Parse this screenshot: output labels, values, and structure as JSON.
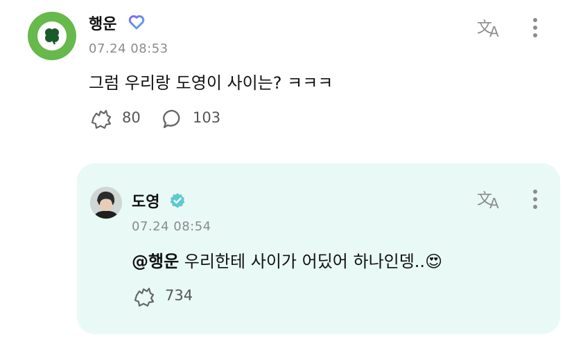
{
  "post": {
    "author": "행운",
    "badge_icon": "heart-outline-badge-icon",
    "timestamp": "07.24 08:53",
    "text": "그럼 우리랑 도영이 사이는? ㅋㅋㅋ",
    "like_count": "80",
    "comment_count": "103",
    "avatar_icon": "clover-icon"
  },
  "reply": {
    "author": "도영",
    "badge_icon": "verified-check-icon",
    "timestamp": "07.24 08:54",
    "mention": "@행운",
    "text": " 우리한테 사이가 어딨어 하나인뎅..",
    "emoji": "😍",
    "like_count": "734"
  },
  "colors": {
    "accent_green": "#66b94a",
    "reply_bg": "#e9f9f5",
    "verified": "#5ec9d3",
    "badge_gradient": [
      "#7b6cf6",
      "#56a8f5"
    ]
  }
}
